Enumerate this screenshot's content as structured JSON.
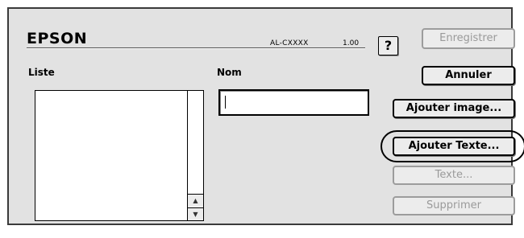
{
  "header": {
    "brand": "EPSON",
    "model": "AL-CXXXX",
    "version": "1.00",
    "help_label": "?"
  },
  "list": {
    "label": "Liste",
    "items": [],
    "scroll_up_label": "▲",
    "scroll_down_label": "▼"
  },
  "name": {
    "label": "Nom",
    "value": ""
  },
  "buttons": {
    "save": "Enregistrer",
    "cancel": "Annuler",
    "add_image": "Ajouter image...",
    "add_text": "Ajouter Texte...",
    "text": "Texte...",
    "delete": "Supprimer"
  }
}
